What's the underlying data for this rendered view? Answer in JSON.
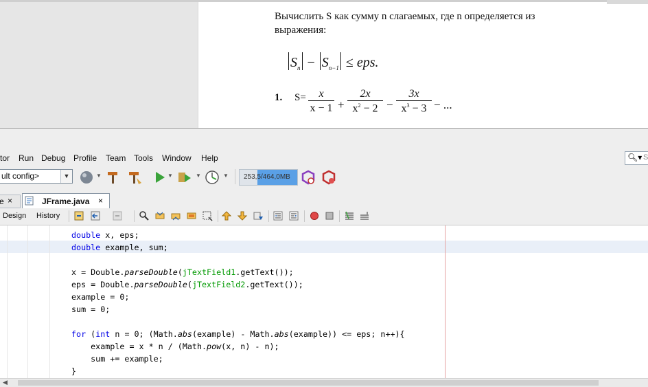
{
  "document": {
    "line1": "Вычислить S как сумму n слагаемых, где n определяется из",
    "line2": "выражения:",
    "formula": {
      "S": "S",
      "sub_n": "n",
      "minus": "−",
      "sub_n1": "n−1",
      "leq": "≤",
      "eps": "eps."
    },
    "item_number": "1.",
    "item_s": "S=",
    "terms": [
      {
        "num": "x",
        "den_base": "x − 1",
        "den_sup": ""
      },
      {
        "num": "2x",
        "den_base": "x",
        "den_sup": "2",
        "den_tail": " − 2"
      },
      {
        "num": "3x",
        "den_base": "x",
        "den_sup": "3",
        "den_tail": " − 3"
      }
    ],
    "ops": [
      "+",
      "−",
      "− ..."
    ]
  },
  "menu": [
    "tor",
    "Run",
    "Debug",
    "Profile",
    "Team",
    "Tools",
    "Window",
    "Help"
  ],
  "search": {
    "placeholder": "S"
  },
  "toolbar": {
    "config_value": "ult config>",
    "memory": "253,5/464,0MB"
  },
  "tabs": {
    "prev_label": "e",
    "active_label": "JFrame.java",
    "close": "×"
  },
  "editor_toolbar": {
    "design": "Design",
    "history": "History"
  },
  "code": {
    "line1": [
      "double",
      " x, eps;"
    ],
    "line2": [
      "double",
      " example, sum;"
    ],
    "line4": {
      "a": "x = Double.",
      "b": "parseDouble",
      "c": "(",
      "d": "jTextField1",
      "e": ".getText());"
    },
    "line5": {
      "a": "eps = Double.",
      "b": "parseDouble",
      "c": "(",
      "d": "jTextField2",
      "e": ".getText());"
    },
    "line6": "example = 0;",
    "line7": "sum = 0;",
    "line9": {
      "for": "for",
      "p1": " (",
      "int": "int",
      "p2": " n = 0; (Math.",
      "abs1": "abs",
      "p3": "(example) - Math.",
      "abs2": "abs",
      "p4": "(example)) <= eps; n++){"
    },
    "line10": {
      "a": "    example = x * n / (Math.",
      "pow": "pow",
      "b": "(x, n) - n);"
    },
    "line11": "    sum += example;",
    "line12": "}"
  },
  "colors": {
    "keyword": "#0000e6",
    "field": "#009900",
    "memory_fill": "#5aa0e6",
    "right_margin": "#e5a0a0"
  }
}
